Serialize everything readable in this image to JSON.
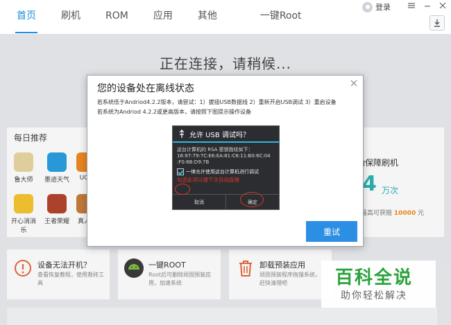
{
  "nav": {
    "tabs": [
      {
        "label": "首页",
        "active": true
      },
      {
        "label": "刷机"
      },
      {
        "label": "ROM"
      },
      {
        "label": "应用"
      },
      {
        "label": "其他"
      },
      {
        "label": "一键Root"
      }
    ],
    "login_label": "登录"
  },
  "status": {
    "connecting": "正在连接，请稍候..."
  },
  "recommend": {
    "title": "每日推荐",
    "apps_row1": [
      "鲁大师",
      "墨迹天气",
      "UC"
    ],
    "apps_row2": [
      "开心消消乐",
      "王者荣耀",
      "真人"
    ]
  },
  "guarantee": {
    "title": "动保障刷机",
    "number": "4",
    "unit": "万次",
    "sub_prefix": "最高可获赔",
    "sub_amount": "10000",
    "sub_suffix": "元"
  },
  "cards": [
    {
      "title": "设备无法开机？",
      "desc1": "查看恢复教程，使用救砖工",
      "desc2": "具"
    },
    {
      "title": "一键ROOT",
      "desc1": "Root后可删除顽固预装应",
      "desc2": "用，加速系统"
    },
    {
      "title": "卸载预装应用",
      "desc1": "顽固预装程序拖慢系统，",
      "desc2": "赶快清理吧"
    }
  ],
  "modal": {
    "title": "您的设备处在离线状态",
    "line1": "若系统低于Andriod4.2.2版本，请尝试：1）拔插USB数据线 2）重新开启USB调试 3）重启设备",
    "line2": "若系统为Andriod 4.2.2或更高版本，请按照下图提示操作设备",
    "retry_label": "重试",
    "phone": {
      "title": "允许 USB 调试吗？",
      "body1": "这台计算机的 RSA 密钥指纹如下：",
      "body2": "16:97:79:7C:E6:EA:81:C6:11:B0:6C:04",
      "body3": ":F0:6B:D9:7B",
      "check_label": "一律允许使用这台计算机进行调试",
      "note": "勾选此项以便下次自动连接",
      "cancel_label": "取消",
      "ok_label": "确定"
    }
  },
  "watermark": {
    "big": "百科全说",
    "small": "助你轻松解决"
  }
}
